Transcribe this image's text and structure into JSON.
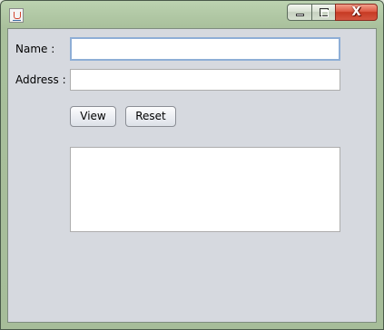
{
  "window": {
    "title": "",
    "icon": "java-cup-icon",
    "controls": {
      "minimize": "minimize-icon",
      "maximize": "maximize-icon",
      "close_glyph": "X"
    }
  },
  "form": {
    "name_label": "Name :",
    "name_value": "",
    "address_label": "Address :",
    "address_value": "",
    "view_button": "View",
    "reset_button": "Reset",
    "output_text": ""
  }
}
